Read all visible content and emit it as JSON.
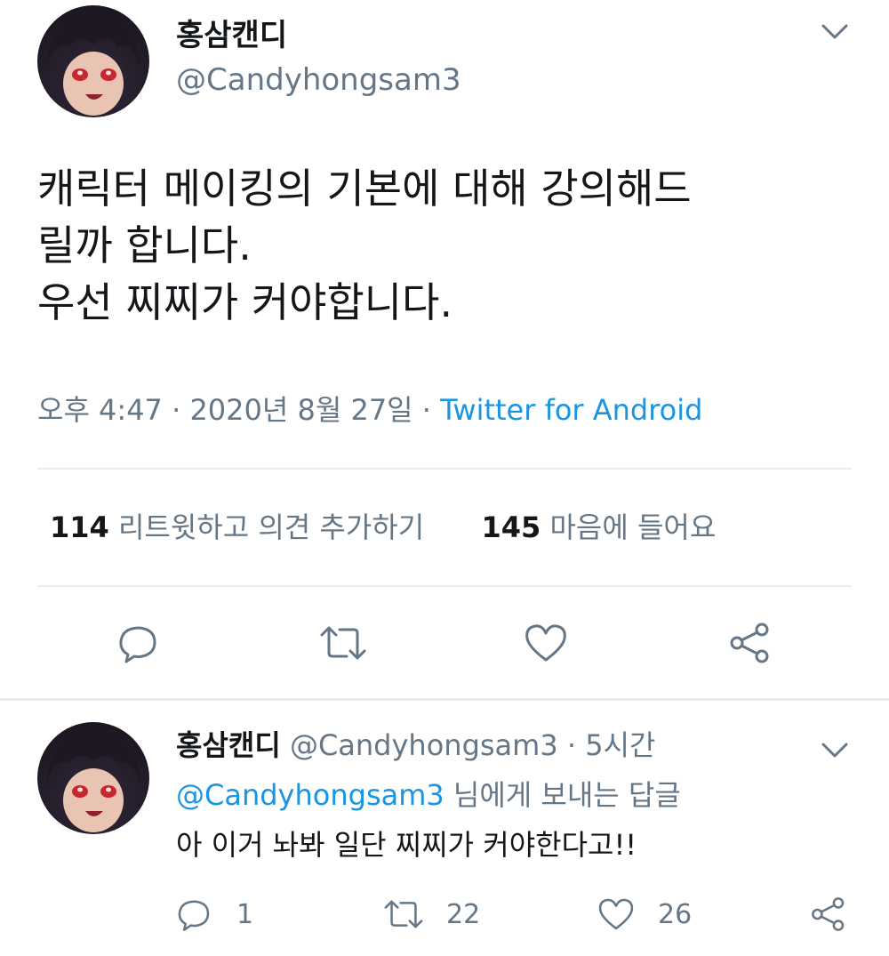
{
  "main_tweet": {
    "display_name": "홍삼캔디",
    "handle": "@Candyhongsam3",
    "text_lines": [
      "캐릭터 메이킹의 기본에 대해 강의해드",
      "릴까 합니다.",
      "우선 찌찌가 커야합니다."
    ],
    "time": "오후 4:47",
    "date": "2020년 8월 27일",
    "separator": "·",
    "source": "Twitter for Android",
    "retweet_count": "114",
    "retweet_label": "리트윗하고 의견 추가하기",
    "like_count": "145",
    "like_label": "마음에 들어요",
    "icons": [
      "reply-icon",
      "retweet-icon",
      "like-icon",
      "share-icon",
      "chevron-down-icon"
    ]
  },
  "reply_tweet": {
    "display_name": "홍삼캔디",
    "handle": "@Candyhongsam3",
    "separator": "·",
    "age": "5시간",
    "reply_to_handle": "@Candyhongsam3",
    "reply_to_suffix": "님에게 보내는 답글",
    "text": "아 이거 놔봐 일단 찌찌가 커야한다고!!",
    "reply_count": "1",
    "retweet_count": "22",
    "like_count": "26"
  },
  "colors": {
    "text": "#14171a",
    "muted": "#657786",
    "link": "#1b95e0",
    "divider": "#e6ecf0"
  }
}
